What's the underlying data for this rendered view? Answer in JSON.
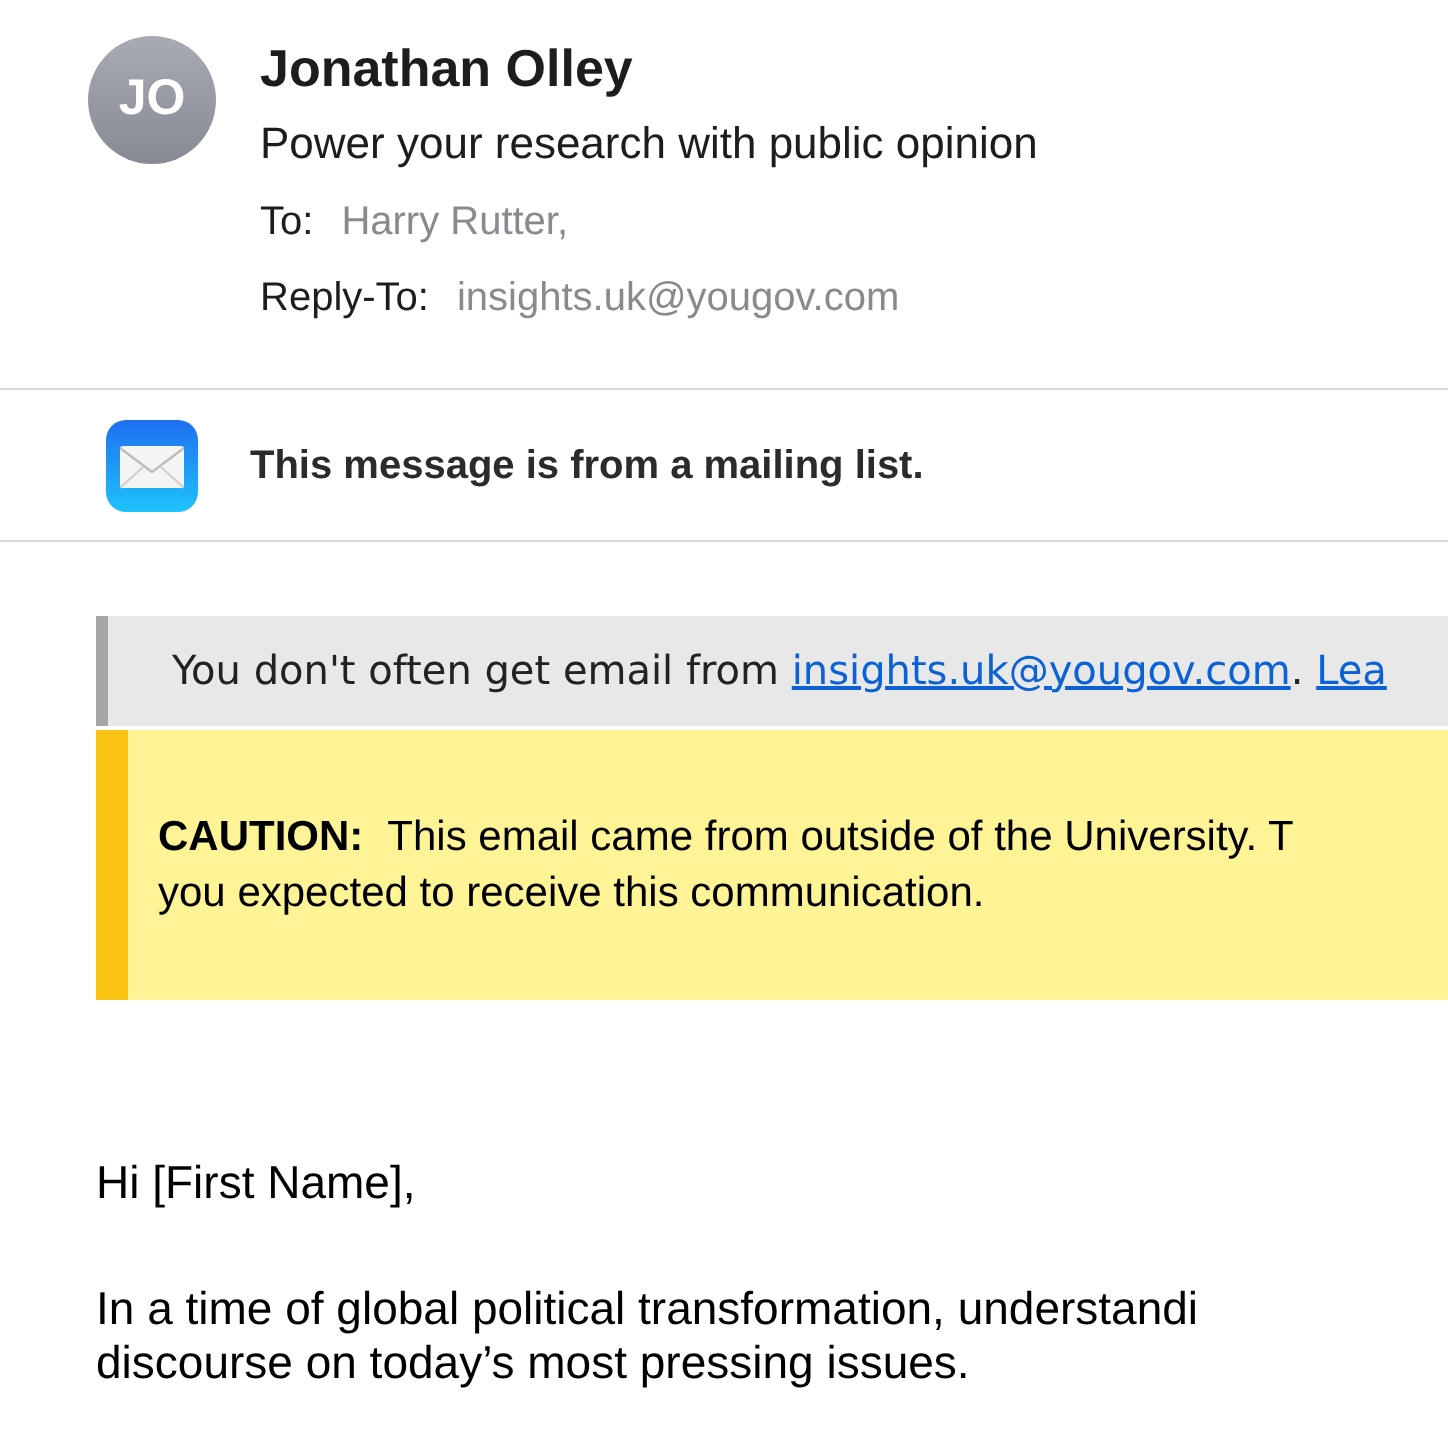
{
  "header": {
    "avatar_initials": "JO",
    "sender": "Jonathan Olley",
    "subject": "Power your research with public opinion",
    "fields": [
      {
        "label": "To:",
        "value": "Harry Rutter,"
      },
      {
        "label": "Reply-To:",
        "value": "insights.uk@yougov.com"
      }
    ]
  },
  "mailing_list_notice": "This message is from a mailing list.",
  "sender_banner": {
    "text": "You don't often get email from ",
    "link": "insights.uk@yougov.com",
    "separator": ". ",
    "link_2": "Lea"
  },
  "caution": {
    "label": "CAUTION:",
    "lines": [
      "This email came from outside of the University. T",
      "you expected to receive this communication."
    ]
  },
  "body": {
    "greeting": "Hi [First Name],",
    "paragraph_lines": [
      "In a time of global political transformation, understandi",
      "discourse on today’s most pressing issues."
    ]
  }
}
